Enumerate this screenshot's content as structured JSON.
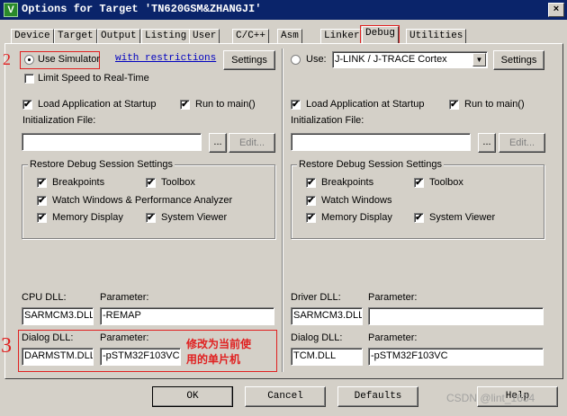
{
  "window": {
    "title": "Options for Target 'TN620GSM&ZHANGJI'",
    "close_glyph": "×"
  },
  "tabs": [
    {
      "label": "Device"
    },
    {
      "label": "Target"
    },
    {
      "label": "Output"
    },
    {
      "label": "Listing"
    },
    {
      "label": "User"
    },
    {
      "label": "C/C++"
    },
    {
      "label": "Asm"
    },
    {
      "label": "Linker"
    },
    {
      "label": "Debug",
      "active": true
    },
    {
      "label": "Utilities"
    }
  ],
  "left": {
    "use_simulator": "Use Simulator",
    "with_restrictions": "with restrictions",
    "settings": "Settings",
    "limit_speed": "Limit Speed to Real-Time",
    "load_app": "Load Application at Startup",
    "run_to_main": "Run to main()",
    "init_file": "Initialization File:",
    "browse": "...",
    "edit": "Edit...",
    "restore_title": "Restore Debug Session Settings",
    "breakpoints": "Breakpoints",
    "toolbox": "Toolbox",
    "watch": "Watch Windows & Performance Analyzer",
    "memory": "Memory Display",
    "sysviewer": "System Viewer",
    "cpu_dll_label": "CPU DLL:",
    "param_label": "Parameter:",
    "cpu_dll": "SARMCM3.DLL",
    "cpu_param": "-REMAP",
    "dialog_dll_label": "Dialog DLL:",
    "dialog_dll": "DARMSTM.DLL",
    "dialog_param": "-pSTM32F103VC"
  },
  "right": {
    "use": "Use:",
    "driver": "J-LINK / J-TRACE Cortex",
    "settings": "Settings",
    "load_app": "Load Application at Startup",
    "run_to_main": "Run to main()",
    "init_file": "Initialization File:",
    "browse": "...",
    "edit": "Edit...",
    "restore_title": "Restore Debug Session Settings",
    "breakpoints": "Breakpoints",
    "toolbox": "Toolbox",
    "watch": "Watch Windows",
    "memory": "Memory Display",
    "sysviewer": "System Viewer",
    "driver_dll_label": "Driver DLL:",
    "param_label": "Parameter:",
    "driver_dll": "SARMCM3.DLL",
    "driver_param": "",
    "dialog_dll_label": "Dialog DLL:",
    "dialog_dll": "TCM.DLL",
    "dialog_param": "-pSTM32F103VC"
  },
  "annotations": {
    "mark2": "2",
    "mark3": "3",
    "note_line1": "修改为当前使",
    "note_line2": "用的单片机",
    "color": "#e02020"
  },
  "footer": {
    "ok": "OK",
    "cancel": "Cancel",
    "defaults": "Defaults",
    "help": "Help"
  },
  "watermark": "CSDN @lint_1634",
  "check_glyph": "✔"
}
